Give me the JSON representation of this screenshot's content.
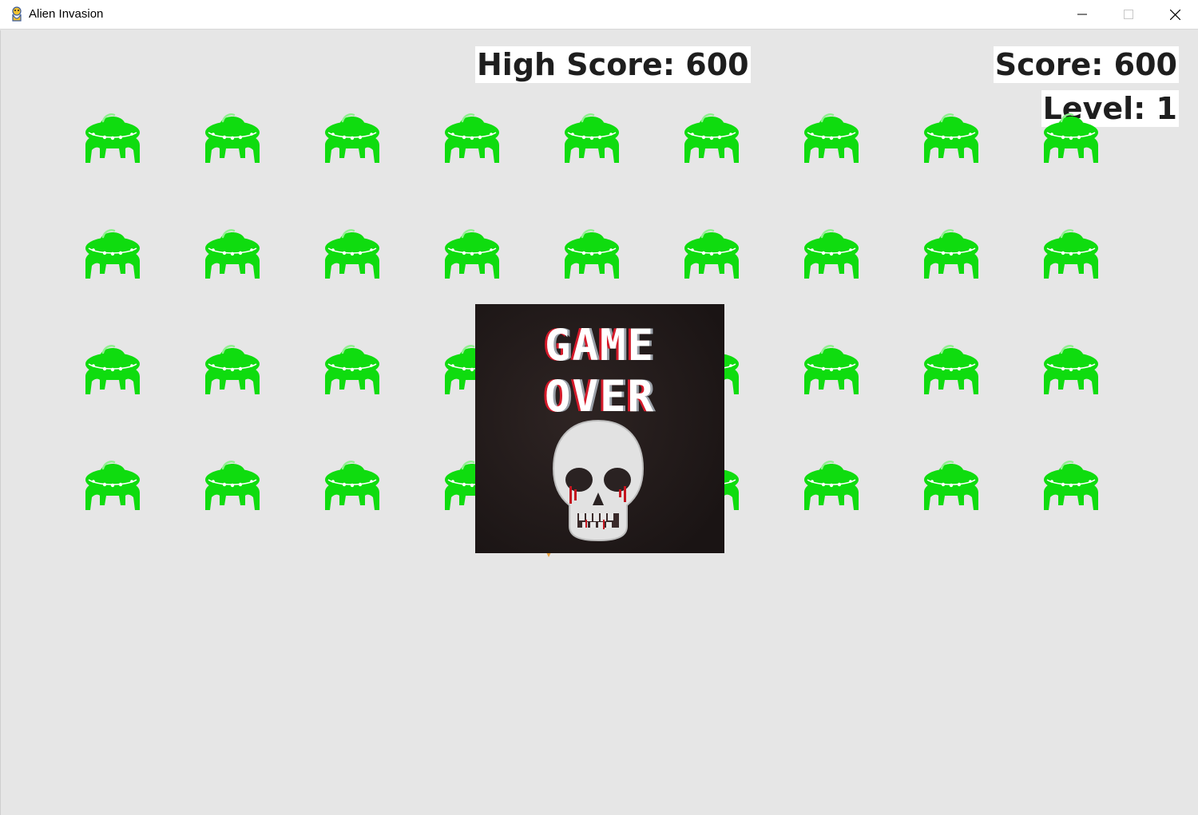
{
  "window": {
    "title": "Alien Invasion",
    "app_icon": "pygame-snake-icon",
    "controls": [
      "minimize-icon",
      "maximize-icon",
      "close-icon"
    ]
  },
  "hud": {
    "high_score": "High Score: 600",
    "score": "Score: 600",
    "level": "Level: 1"
  },
  "aliens": {
    "rows": 4,
    "columns": 9,
    "icon": "ufo-alien-icon",
    "color": "#0fdc0f"
  },
  "game_over": {
    "line1": "GAME",
    "line2": "OVER",
    "icon": "skull-icon",
    "background": "#241c1b"
  },
  "colors": {
    "background": "#e6e6e6",
    "hud_bg": "#ffffff",
    "hud_text": "#1e1e1e"
  }
}
